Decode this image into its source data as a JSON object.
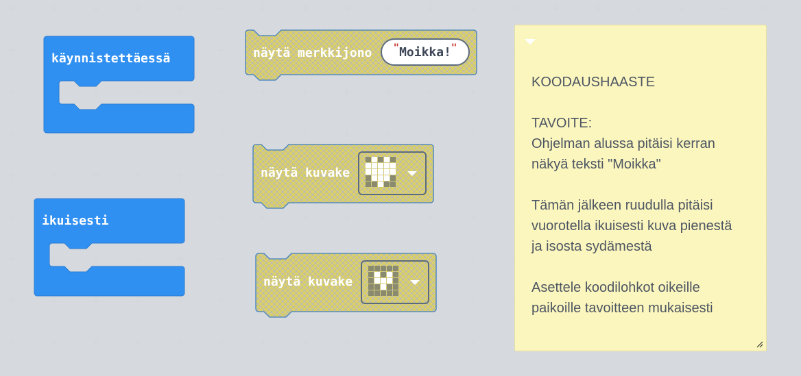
{
  "workspace": {
    "blocks": {
      "on_start": {
        "label": "käynnistettäessä",
        "color": "#3090f2"
      },
      "forever": {
        "label": "ikuisesti",
        "color": "#3090f2"
      },
      "show_string": {
        "label": "näytä merkkijono",
        "value": "Moikka!",
        "disabled": true
      },
      "show_icon_1": {
        "label": "näytä kuvake",
        "icon": "small-heart-icon",
        "disabled": true
      },
      "show_icon_2": {
        "label": "näytä kuvake",
        "icon": "heart-outline-icon",
        "disabled": true
      }
    },
    "colors": {
      "background": "#eceff2",
      "block_blue": "#3090f2",
      "disabled_fill": "#c9c49a",
      "disabled_hatch": "#e0d55a"
    }
  },
  "comment": {
    "lines": [
      "KOODAUSHAASTE",
      "",
      "TAVOITE:",
      "Ohjelman alussa pitäisi kerran",
      "näkyä teksti \"Moikka\"",
      "",
      "Tämän jälkeen ruudulla pitäisi",
      "vuorotella ikuisesti kuva pienestä",
      "ja isosta sydämestä",
      "",
      "Asettele koodilohkot oikeille",
      "paikoille tavoitteen mukaisesti"
    ],
    "background": "#fbf6bd"
  }
}
